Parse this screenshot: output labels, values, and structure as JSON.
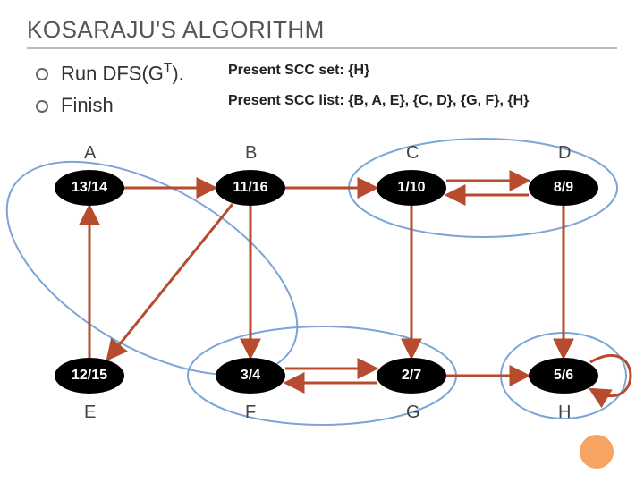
{
  "title": "KOSARAJU'S ALGORITHM",
  "bullets": {
    "b1_pre": "Run DFS(G",
    "b1_sup": "T",
    "b1_post": ").",
    "b2": "Finish"
  },
  "info": {
    "set_label": "Present SCC set: {H}",
    "list_label": "Present SCC list: {B, A, E}, {C, D}, {G, F}, {H}"
  },
  "nodes": {
    "A": {
      "label": "A",
      "val": "13/14"
    },
    "B": {
      "label": "B",
      "val": "11/16"
    },
    "C": {
      "label": "C",
      "val": "1/10"
    },
    "D": {
      "label": "D",
      "val": "8/9"
    },
    "E": {
      "label": "E",
      "val": "12/15"
    },
    "F": {
      "label": "F",
      "val": "3/4"
    },
    "G": {
      "label": "G",
      "val": "2/7"
    },
    "H": {
      "label": "H",
      "val": "5/6"
    }
  },
  "chart_data": {
    "type": "diagram",
    "title": "Kosaraju's Algorithm step",
    "scc_set": [
      "H"
    ],
    "scc_list": [
      [
        "B",
        "A",
        "E"
      ],
      [
        "C",
        "D"
      ],
      [
        "G",
        "F"
      ],
      [
        "H"
      ]
    ],
    "vertices": [
      {
        "id": "A",
        "times": "13/14"
      },
      {
        "id": "B",
        "times": "11/16"
      },
      {
        "id": "C",
        "times": "1/10"
      },
      {
        "id": "D",
        "times": "8/9"
      },
      {
        "id": "E",
        "times": "12/15"
      },
      {
        "id": "F",
        "times": "3/4"
      },
      {
        "id": "G",
        "times": "2/7"
      },
      {
        "id": "H",
        "times": "5/6"
      }
    ],
    "edges": [
      {
        "from": "A",
        "to": "B"
      },
      {
        "from": "E",
        "to": "A"
      },
      {
        "from": "B",
        "to": "E"
      },
      {
        "from": "B",
        "to": "F"
      },
      {
        "from": "B",
        "to": "C"
      },
      {
        "from": "C",
        "to": "D"
      },
      {
        "from": "D",
        "to": "C"
      },
      {
        "from": "C",
        "to": "G"
      },
      {
        "from": "D",
        "to": "H"
      },
      {
        "from": "F",
        "to": "G"
      },
      {
        "from": "G",
        "to": "F"
      },
      {
        "from": "G",
        "to": "H"
      },
      {
        "from": "H",
        "to": "H"
      }
    ],
    "scc_ellipses": [
      {
        "members": [
          "A",
          "B",
          "E"
        ]
      },
      {
        "members": [
          "C",
          "D"
        ]
      },
      {
        "members": [
          "F",
          "G"
        ]
      },
      {
        "members": [
          "H"
        ]
      }
    ]
  }
}
